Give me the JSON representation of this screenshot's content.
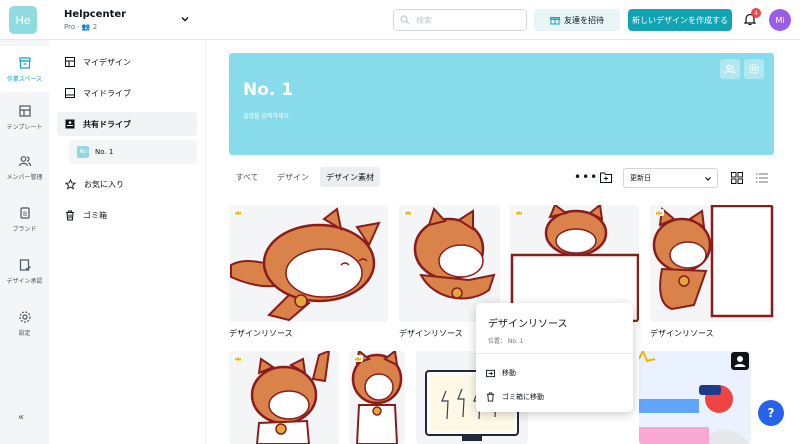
{
  "header": {
    "logo_text": "He",
    "team_name": "Helpcenter",
    "team_plan": "Pro · 👥 2",
    "search_placeholder": "検索",
    "invite_label": "友達を招待",
    "create_label": "新しいデザインを作成する",
    "notification_count": "4",
    "avatar_initials": "Mi"
  },
  "rail": {
    "items": [
      {
        "label": "作業スペース",
        "icon": "workspace-icon"
      },
      {
        "label": "テンプレート",
        "icon": "template-icon"
      },
      {
        "label": "メンバー管理",
        "icon": "members-icon"
      },
      {
        "label": "ブランド",
        "icon": "brand-icon"
      },
      {
        "label": "デザイン承認",
        "icon": "approval-icon"
      },
      {
        "label": "設定",
        "icon": "settings-icon"
      }
    ],
    "collapse_label": "«"
  },
  "nav": {
    "items": [
      {
        "label": "マイデザイン"
      },
      {
        "label": "マイドライブ"
      },
      {
        "label": "共有ドライブ"
      },
      {
        "label": "お気に入り"
      },
      {
        "label": "ゴミ箱"
      }
    ],
    "sub_item": {
      "chip": "No",
      "label": "No. 1"
    }
  },
  "banner": {
    "title": "No. 1",
    "subtitle": "설명을 입력하세요."
  },
  "filters": {
    "tabs": [
      {
        "label": "すべて"
      },
      {
        "label": "デザイン"
      },
      {
        "label": "デザイン素材"
      }
    ],
    "sort_label": "更新日"
  },
  "cards": [
    {
      "label": "デザインリソース"
    },
    {
      "label": "デザインリソース"
    },
    {
      "label": "デザインリソース"
    }
  ],
  "context_menu": {
    "title": "デザインリソース",
    "location": "位置： No. 1",
    "move_label": "移動",
    "trash_label": "ゴミ箱に移動"
  },
  "help_label": "?",
  "colors": {
    "accent": "#10a4b4",
    "banner": "#87dbea",
    "cat_orange": "#d9824a",
    "cat_outline": "#8a1c1c"
  }
}
